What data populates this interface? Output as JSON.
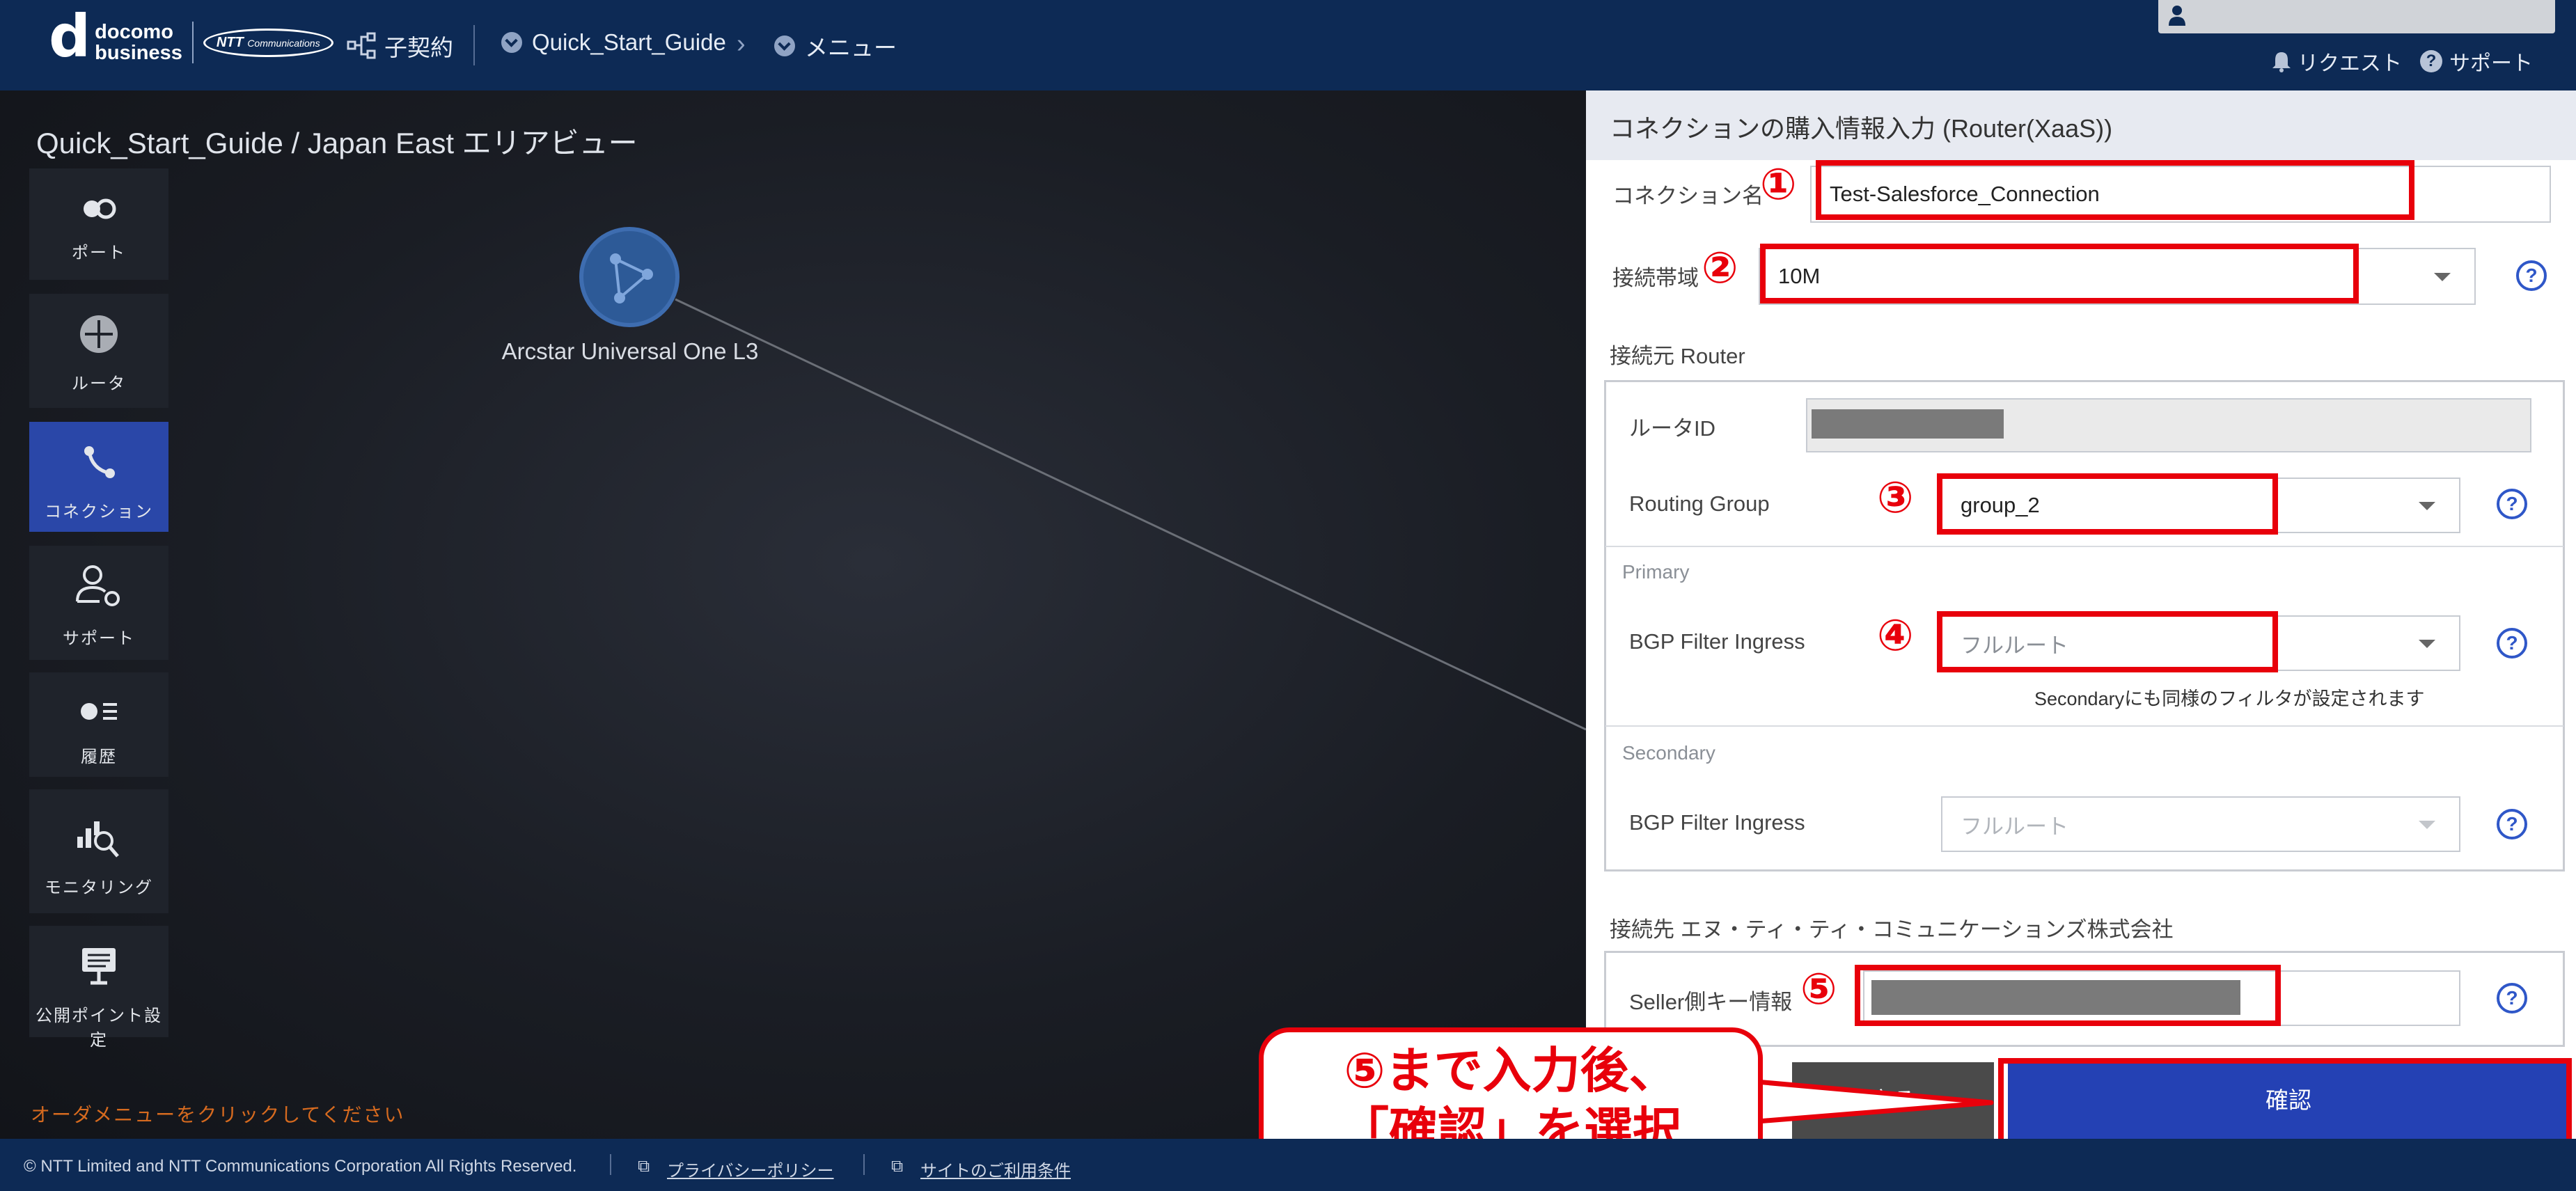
{
  "header": {
    "brand_top": "docomo",
    "brand_bottom": "business",
    "ntt_logo": "NTT",
    "ntt_logo_sub": "Communications",
    "contract": "子契約",
    "project": "Quick_Start_Guide",
    "menu": "メニュー",
    "request": "リクエスト",
    "support": "サポート"
  },
  "canvas": {
    "breadcrumb": "Quick_Start_Guide / Japan East エリアビュー",
    "node_label": "Arcstar Universal One L3",
    "order_hint": "オーダメニューをクリックしてください"
  },
  "sidebar": {
    "items": [
      {
        "label": "ポート",
        "icon": "port-icon"
      },
      {
        "label": "ルータ",
        "icon": "router-icon"
      },
      {
        "label": "コネクション",
        "icon": "connection-icon"
      },
      {
        "label": "サポート",
        "icon": "support-icon"
      },
      {
        "label": "履歴",
        "icon": "history-icon"
      },
      {
        "label": "モニタリング",
        "icon": "monitoring-icon"
      },
      {
        "label": "公開ポイント設定",
        "icon": "public-point-icon"
      }
    ]
  },
  "panel": {
    "title": "コネクションの購入情報入力 (Router(XaaS))",
    "connection_name_label": "コネクション名",
    "connection_name_value": "Test-Salesforce_Connection",
    "bandwidth_label": "接続帯域",
    "bandwidth_value": "10M",
    "source_router_label": "接続元 Router",
    "router_id_label": "ルータID",
    "routing_group_label": "Routing Group",
    "routing_group_value": "group_2",
    "primary_label": "Primary",
    "bgp_ingress_label": "BGP Filter Ingress",
    "bgp_primary_value": "フルルート",
    "secondary_hint": "Secondaryにも同様のフィルタが設定されます",
    "secondary_label": "Secondary",
    "bgp_secondary_value": "フルルート",
    "dest_label": "接続先 エヌ・ティ・ティ・コミュニケーションズ株式会社",
    "seller_key_label": "Seller側キー情報",
    "back_button": "戻る",
    "confirm_button": "確認",
    "help_glyph": "?"
  },
  "annotations": {
    "markers": [
      "①",
      "②",
      "③",
      "④",
      "⑤"
    ],
    "callout_line1": "⑤まで入力後、",
    "callout_line2": "「確認」を選択"
  },
  "footer": {
    "copyright": "© NTT Limited and NTT Communications Corporation All Rights Reserved.",
    "privacy": "プライバシーポリシー",
    "terms": "サイトのご利用条件"
  },
  "colors": {
    "header_bg": "#0d2a55",
    "accent_blue": "#2441b4",
    "annotation_red": "#e8000b",
    "hint_orange": "#d66a1f"
  }
}
